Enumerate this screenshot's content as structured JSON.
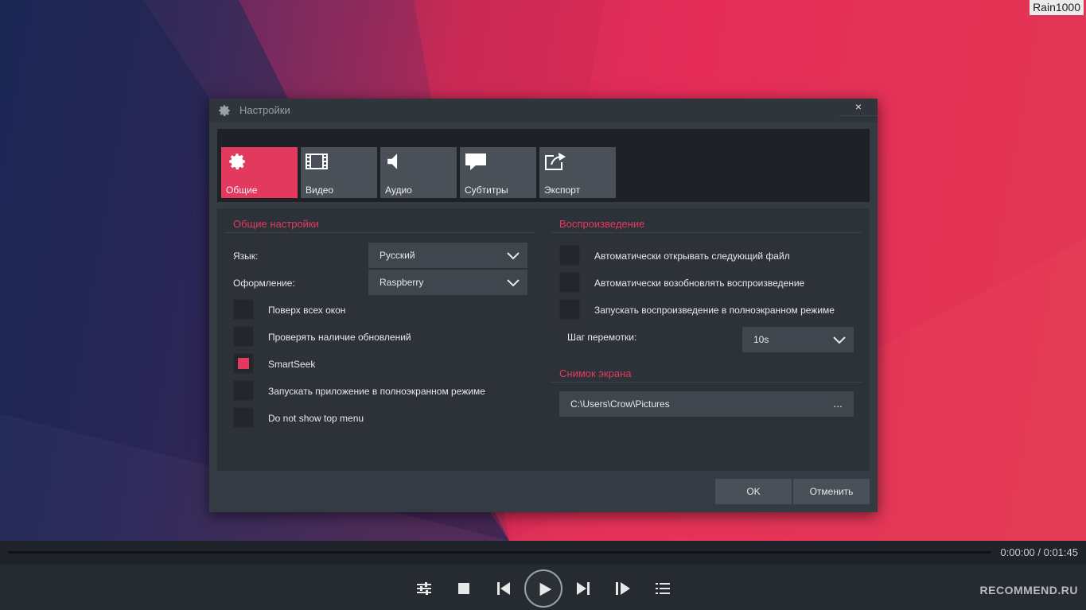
{
  "watermark_top": "Rain1000",
  "dialog": {
    "title": "Настройки",
    "close_label": "×",
    "tabs": [
      {
        "label": "Общие",
        "icon": "gear-icon"
      },
      {
        "label": "Видео",
        "icon": "film-icon"
      },
      {
        "label": "Аудио",
        "icon": "speaker-icon"
      },
      {
        "label": "Субтитры",
        "icon": "speech-bubble-icon"
      },
      {
        "label": "Экспорт",
        "icon": "export-icon"
      }
    ],
    "general": {
      "title": "Общие настройки",
      "language_label": "Язык:",
      "language_value": "Русский",
      "theme_label": "Оформление:",
      "theme_value": "Raspberry",
      "checkboxes": [
        {
          "label": "Поверх всех окон",
          "checked": false
        },
        {
          "label": "Проверять наличие обновлений",
          "checked": false
        },
        {
          "label": "SmartSeek",
          "checked": true
        },
        {
          "label": "Запускать приложение в полноэкранном режиме",
          "checked": false
        },
        {
          "label": "Do not show top menu",
          "checked": false
        }
      ]
    },
    "playback": {
      "title": "Воспроизведение",
      "checkboxes": [
        {
          "label": "Автоматически открывать следующий файл",
          "checked": false
        },
        {
          "label": "Автоматически возобновлять воспроизведение",
          "checked": false
        },
        {
          "label": "Запускать воспроизведение в полноэкранном режиме",
          "checked": false
        }
      ],
      "seek_step_label": "Шаг перемотки:",
      "seek_step_value": "10s"
    },
    "screenshot": {
      "title": "Снимок экрана",
      "path": "C:\\Users\\Crow\\Pictures",
      "browse_label": "..."
    },
    "ok_label": "OK",
    "cancel_label": "Отменить"
  },
  "player": {
    "time": "0:00:00 / 0:01:45",
    "watermark_bottom": "RECOMMEND.RU"
  },
  "colors": {
    "accent": "#e4395e",
    "dialog_bg": "#353b43",
    "panel_bg": "#2d3238"
  }
}
